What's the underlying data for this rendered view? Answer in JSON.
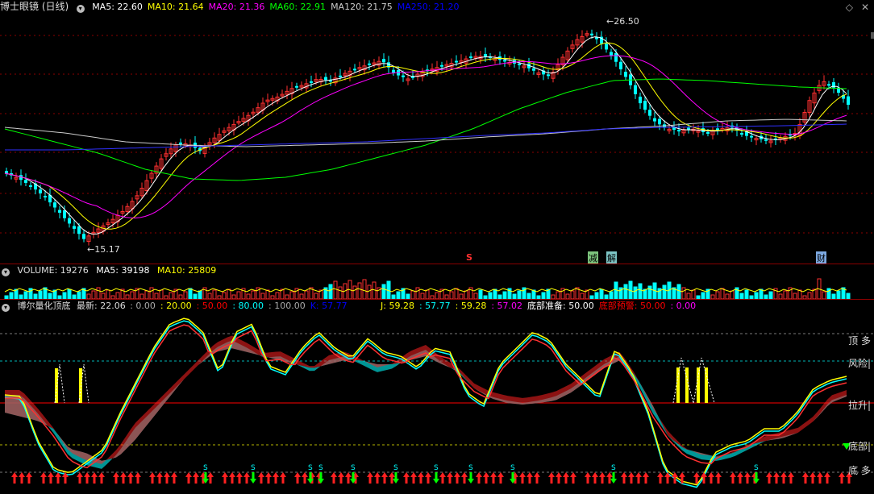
{
  "main": {
    "title": "博士眼镜 (日线)",
    "ma": [
      {
        "label": "MA5: 22.60",
        "color": "#ffffff"
      },
      {
        "label": "MA10: 21.64",
        "color": "#ffff00"
      },
      {
        "label": "MA20: 21.36",
        "color": "#ff00ff"
      },
      {
        "label": "MA60: 22.91",
        "color": "#00ff00"
      },
      {
        "label": "MA120: 21.75",
        "color": "#cccccc"
      },
      {
        "label": "MA250: 21.20",
        "color": "#0000ff"
      }
    ],
    "high_label": "26.50",
    "low_label": "15.17",
    "event_s": "S",
    "event_jian": "减",
    "event_jie": "解",
    "event_cai": "财"
  },
  "volume": {
    "label": "VOLUME: 19276",
    "ma5": "MA5: 39198",
    "ma10": "MA10: 25809"
  },
  "indicator": {
    "name": "博尔量化顶底",
    "latest": "最新: 22.06",
    "levels": [
      {
        "label": ": 0.00",
        "color": "#aaaaaa"
      },
      {
        "label": ": 20.00",
        "color": "#ffff00"
      },
      {
        "label": ": 50.00",
        "color": "#ff0000"
      },
      {
        "label": ": 80.00",
        "color": "#00ffff"
      },
      {
        "label": ": 100.00",
        "color": "#aaaaaa"
      },
      {
        "label": "K: 57.77",
        "color": "#0000ff"
      }
    ],
    "jvals": [
      {
        "label": "J: 59.28",
        "color": "#ffff00"
      },
      {
        "label": ": 57.77",
        "color": "#00ffff"
      },
      {
        "label": ": 59.28",
        "color": "#ffff00"
      },
      {
        "label": ": 57.02",
        "color": "#ff00ff"
      },
      {
        "label": "底部准备: 50.00",
        "color": "#ffffff"
      },
      {
        "label": "底部预警: 50.00",
        "color": "#ff0000"
      },
      {
        "label": ": 0.00",
        "color": "#ff00ff"
      }
    ],
    "right_labels": {
      "top": "顶 多",
      "risk": "风险|",
      "lift": "拉升|",
      "bottom": "底部|",
      "bottom2": "底 多"
    },
    "s_mark": "S"
  },
  "colors": {
    "up": "#ff3030",
    "down": "#00ffff",
    "grid": "#8b0000"
  }
}
